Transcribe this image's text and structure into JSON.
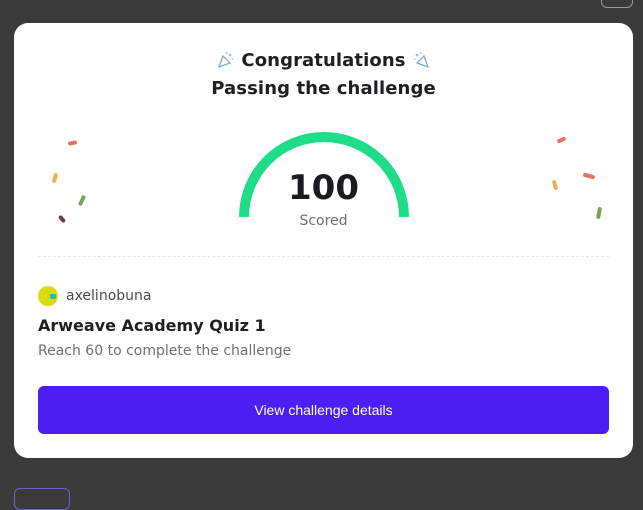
{
  "header": {
    "congrats": "Congratulations",
    "subtitle": "Passing the challenge",
    "party_icon": "party-popper-icon"
  },
  "score": {
    "value": "100",
    "label": "Scored",
    "fraction": 1.0,
    "gauge_color": "#1fdc86"
  },
  "user": {
    "name": "axelinobuna",
    "avatar_color": "#d6dc12"
  },
  "quiz": {
    "title": "Arweave Academy Quiz 1",
    "requirement": "Reach 60 to complete the challenge"
  },
  "actions": {
    "details_label": "View challenge details",
    "button_color": "#4b1ef2"
  }
}
